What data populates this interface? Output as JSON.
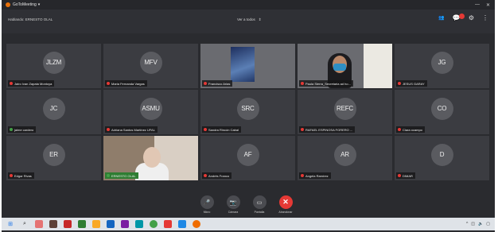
{
  "window": {
    "app_name": "GoToMeeting",
    "speaker_label": "Hablando: ERNESTO OLAL",
    "view_all_label": "Ver a todos"
  },
  "participants": [
    {
      "name": "Jairo Ivan Zapata Montoya",
      "initials": "JLZM",
      "muted": true,
      "video": false
    },
    {
      "name": "Maria Fernanda Vargas",
      "initials": "MFV",
      "muted": true,
      "video": false
    },
    {
      "name": "Francisco Arias",
      "initials": "",
      "muted": true,
      "video": true
    },
    {
      "name": "Paula Sierra_Secretaria ad ho...",
      "initials": "",
      "muted": true,
      "video": true
    },
    {
      "name": "JESUS GARAY",
      "initials": "JG",
      "muted": true,
      "video": false
    },
    {
      "name": "jaime cardero",
      "initials": "JC",
      "muted": false,
      "video": false
    },
    {
      "name": "Adriana Santos Martinez UFAL",
      "initials": "ASMU",
      "muted": true,
      "video": false
    },
    {
      "name": "Sandra Rincón Cabal",
      "initials": "SRC",
      "muted": true,
      "video": false
    },
    {
      "name": "RAFAEL ESPINOSA FORERO ...",
      "initials": "REFC",
      "muted": true,
      "video": false
    },
    {
      "name": "Clara ocampo",
      "initials": "CO",
      "muted": true,
      "video": false
    },
    {
      "name": "Edgar Rivas",
      "initials": "ER",
      "muted": true,
      "video": false
    },
    {
      "name": "ERNESTO OLAL",
      "initials": "",
      "muted": false,
      "video": true
    },
    {
      "name": "Andrés Franco",
      "initials": "AF",
      "muted": true,
      "video": false
    },
    {
      "name": "Angela Ramírez",
      "initials": "AR",
      "muted": true,
      "video": false
    },
    {
      "name": "DIMAR",
      "initials": "D",
      "muted": true,
      "video": false
    }
  ],
  "controls": {
    "mic_label": "Micro",
    "camera_label": "Cámara",
    "screen_label": "Pantalla",
    "leave_label": "Abandonar"
  },
  "icons": {
    "mic": "microphone-icon",
    "camera": "camera-icon",
    "screen": "screen-share-icon",
    "leave": "close-icon"
  },
  "colors": {
    "background": "#2a2b2f",
    "tile": "#3b3c41",
    "muted": "#e53935",
    "leave": "#e53935",
    "brand": "#e8710a"
  }
}
